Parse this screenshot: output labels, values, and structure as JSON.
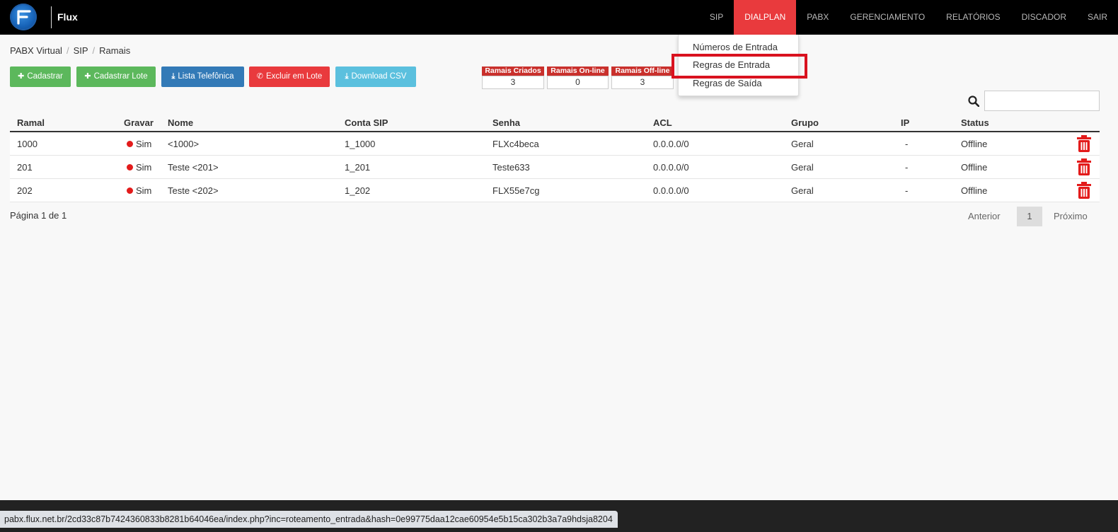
{
  "header": {
    "brand": "Flux",
    "nav": [
      "SIP",
      "DIALPLAN",
      "PABX",
      "GERENCIAMENTO",
      "RELATÓRIOS",
      "DISCADOR",
      "SAIR"
    ],
    "active_nav": "DIALPLAN",
    "accent_color": "#e93a3d"
  },
  "dropdown": {
    "items": [
      "Números de Entrada",
      "Regras de Entrada",
      "Regras de Saída"
    ],
    "highlighted": "Regras de Entrada"
  },
  "breadcrumb": [
    "PABX Virtual",
    "SIP",
    "Ramais"
  ],
  "toolbar": {
    "cadastrar": "Cadastrar",
    "cadastrar_lote": "Cadastrar Lote",
    "lista_telefonica": "Lista Telefônica",
    "excluir_lote": "Excluir em Lote",
    "download_csv": "Download CSV"
  },
  "stats": [
    {
      "label": "Ramais Criados",
      "value": "3"
    },
    {
      "label": "Ramais On-line",
      "value": "0"
    },
    {
      "label": "Ramais Off-line",
      "value": "3"
    }
  ],
  "search": {
    "placeholder": ""
  },
  "table": {
    "headers": [
      "Ramal",
      "Gravar",
      "Nome",
      "Conta SIP",
      "Senha",
      "ACL",
      "Grupo",
      "IP",
      "Status"
    ],
    "rows": [
      {
        "ramal": "1000",
        "gravar": "Sim",
        "nome": "<1000>",
        "conta": "1_1000",
        "senha": "FLXc4beca",
        "acl": "0.0.0.0/0",
        "grupo": "Geral",
        "ip": "-",
        "status": "Offline"
      },
      {
        "ramal": "201",
        "gravar": "Sim",
        "nome": "Teste <201>",
        "conta": "1_201",
        "senha": "Teste633",
        "acl": "0.0.0.0/0",
        "grupo": "Geral",
        "ip": "-",
        "status": "Offline"
      },
      {
        "ramal": "202",
        "gravar": "Sim",
        "nome": "Teste <202>",
        "conta": "1_202",
        "senha": "FLX55e7cg",
        "acl": "0.0.0.0/0",
        "grupo": "Geral",
        "ip": "-",
        "status": "Offline"
      }
    ]
  },
  "pagination": {
    "info": "Página 1 de 1",
    "prev": "Anterior",
    "current": "1",
    "next": "Próximo"
  },
  "status_url": "pabx.flux.net.br/2cd33c87b7424360833b8281b64046ea/index.php?inc=roteamento_entrada&hash=0e99775daa12cae60954e5b15ca302b3a7a9hdsja8204"
}
